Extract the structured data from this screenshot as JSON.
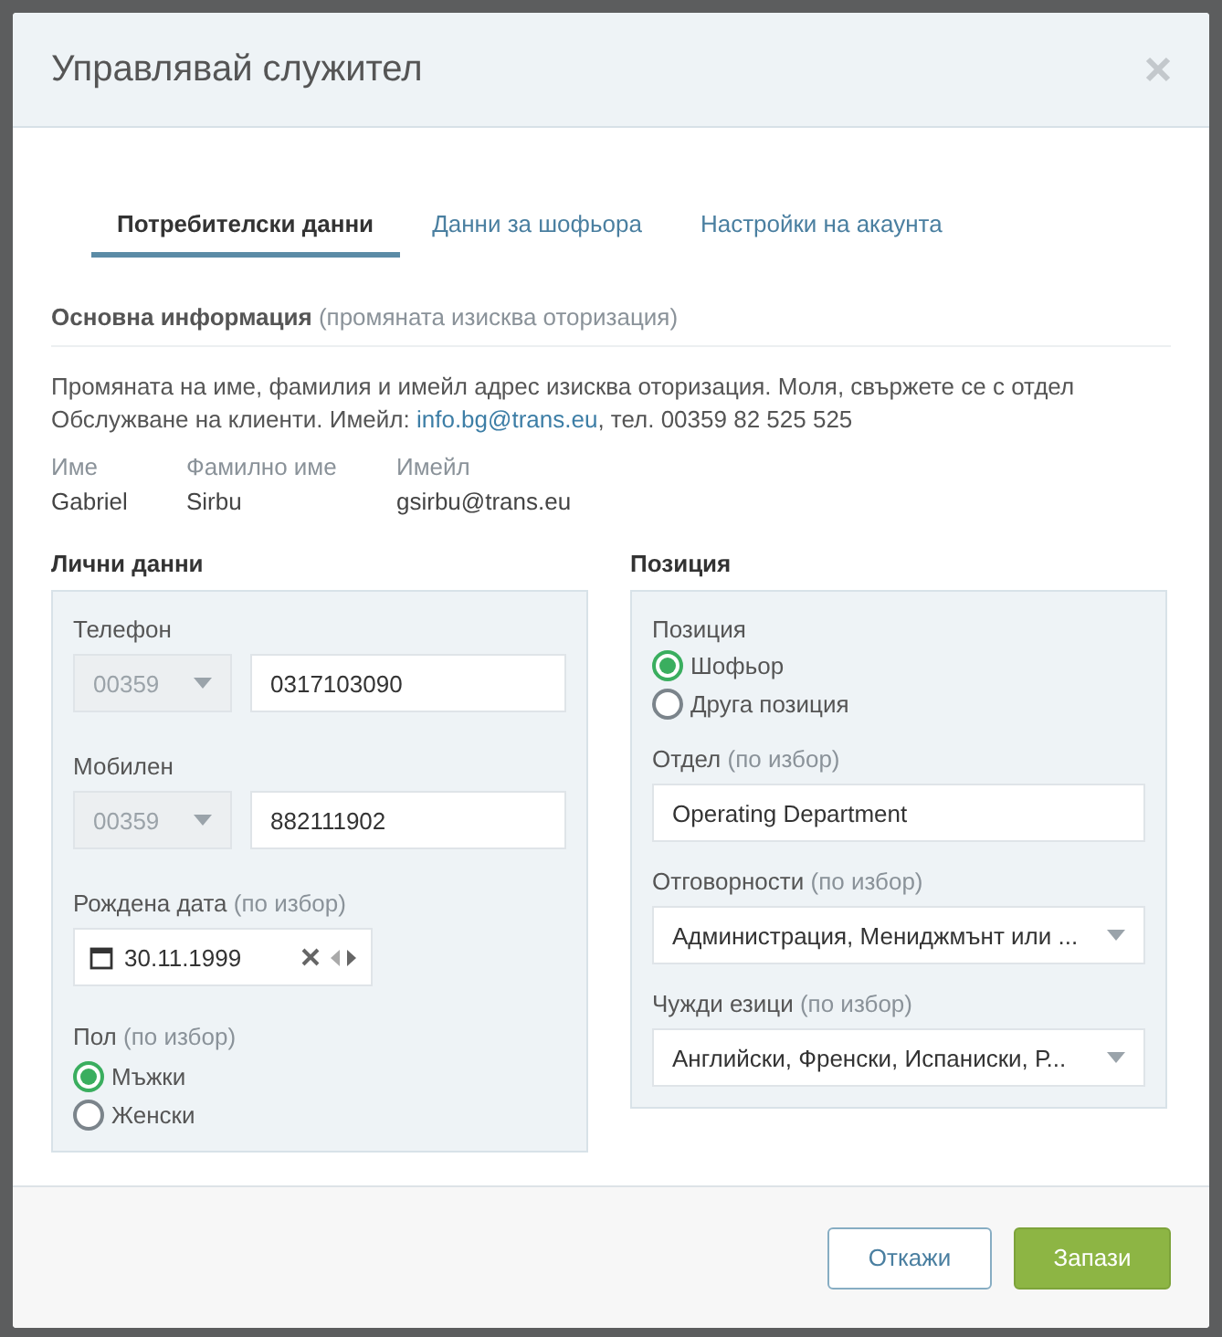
{
  "dialog": {
    "title": "Управлявай служител"
  },
  "tabs": [
    {
      "label": "Потребителски данни",
      "selected": true
    },
    {
      "label": "Данни за шофьора",
      "selected": false
    },
    {
      "label": "Настройки на акаунта",
      "selected": false
    }
  ],
  "basic_info": {
    "heading": "Основна информация",
    "note": "(промяната изисква оторизация)",
    "message": "Промяната на име, фамилия и имейл адрес изисква оторизация. Моля, свържете се с отдел Обслужване на клиенти. Имейл: ",
    "link": "info.bg@trans.eu",
    "message_end": ", тел. 00359 82 525 525",
    "fields": [
      {
        "label": "Име",
        "value": "Gabriel"
      },
      {
        "label": "Фамилно име",
        "value": "Sirbu"
      },
      {
        "label": "Имейл",
        "value": "gsirbu@trans.eu"
      }
    ]
  },
  "personal": {
    "heading": "Лични данни",
    "phones": [
      {
        "label": "Телефон",
        "code": "00359",
        "code_disabled": true,
        "number": "0317103090"
      },
      {
        "label": "Мобилен",
        "code": "00359",
        "code_disabled": true,
        "number": "882111902"
      }
    ],
    "birth_date": {
      "label": "Рождена дата",
      "optional": "(по избор)",
      "value": "30.11.1999"
    },
    "gender": {
      "label": "Пол",
      "optional": "(по избор)",
      "options": [
        {
          "label": "Мъжки",
          "selected": true
        },
        {
          "label": "Женски",
          "selected": false
        }
      ]
    }
  },
  "position": {
    "heading": "Позиция",
    "position": {
      "label": "Позиция",
      "options": [
        {
          "label": "Шофьор",
          "selected": true
        },
        {
          "label": "Друга позиция",
          "selected": false
        }
      ]
    },
    "fields": [
      {
        "kind": "input",
        "label": "Отдел",
        "optional": "(по избор)",
        "value": "Operating Department"
      },
      {
        "kind": "select",
        "label": "Отговорности",
        "optional": "(по избор)",
        "value": "Администрация, Мениджмънт или ..."
      },
      {
        "kind": "select",
        "label": "Чужди езици",
        "optional": "(по избор)",
        "value": "Английски, Френски, Испаниски, Р..."
      }
    ]
  },
  "buttons": [
    {
      "label": "Откажи",
      "kind": "secondary"
    },
    {
      "label": "Запази",
      "kind": "primary"
    }
  ]
}
